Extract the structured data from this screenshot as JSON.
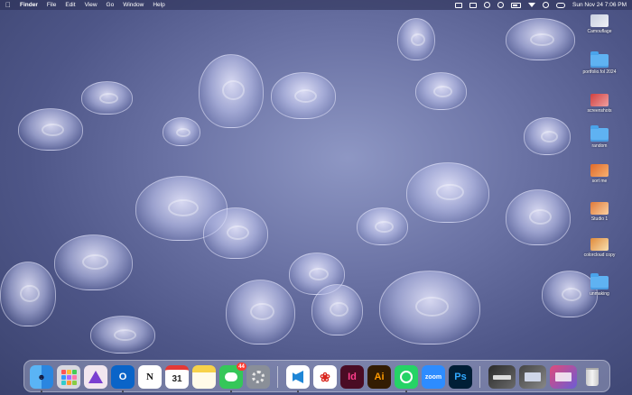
{
  "menubar": {
    "apple": "",
    "app": "Finder",
    "menus": [
      "File",
      "Edit",
      "View",
      "Go",
      "Window",
      "Help"
    ],
    "status_icons": [
      "screen-record-icon",
      "display-icon",
      "pen-icon",
      "vpn-icon",
      "battery-icon",
      "wifi-icon",
      "search-icon",
      "control-center-icon"
    ],
    "clock": "Sun Nov 24  7:06 PM"
  },
  "desktop": {
    "items": [
      {
        "label": "Camouflage",
        "kind": "image"
      },
      {
        "label": "portfolio.fol 2024",
        "kind": "folder"
      },
      {
        "label": "screenshots",
        "kind": "image"
      },
      {
        "label": "random",
        "kind": "folder"
      },
      {
        "label": "sort me",
        "kind": "image"
      },
      {
        "label": "Studio 1",
        "kind": "image"
      },
      {
        "label": "colorcloud copy",
        "kind": "image"
      },
      {
        "label": "unmaking",
        "kind": "folder"
      }
    ]
  },
  "dock": {
    "apps": [
      {
        "name": "Finder",
        "text": ""
      },
      {
        "name": "Launchpad",
        "text": ""
      },
      {
        "name": "Affinity",
        "text": ""
      },
      {
        "name": "Outlook",
        "text": "O"
      },
      {
        "name": "Notion",
        "text": "N"
      },
      {
        "name": "Calendar",
        "text": "31"
      },
      {
        "name": "Notes",
        "text": ""
      },
      {
        "name": "Messages",
        "text": "",
        "badge": "44"
      },
      {
        "name": "System Settings",
        "text": ""
      },
      {
        "name": "Visual Studio Code",
        "text": ""
      },
      {
        "name": "Acrobat",
        "text": ""
      },
      {
        "name": "InDesign",
        "text": "Id"
      },
      {
        "name": "Illustrator",
        "text": "Ai"
      },
      {
        "name": "WhatsApp",
        "text": ""
      },
      {
        "name": "Zoom",
        "text": "zoom"
      },
      {
        "name": "Photoshop",
        "text": "Ps"
      }
    ],
    "trash": "Trash"
  },
  "colors": {
    "menubar": "#282c50",
    "folder": "#5fb2f2",
    "badge": "#ff3b30"
  }
}
